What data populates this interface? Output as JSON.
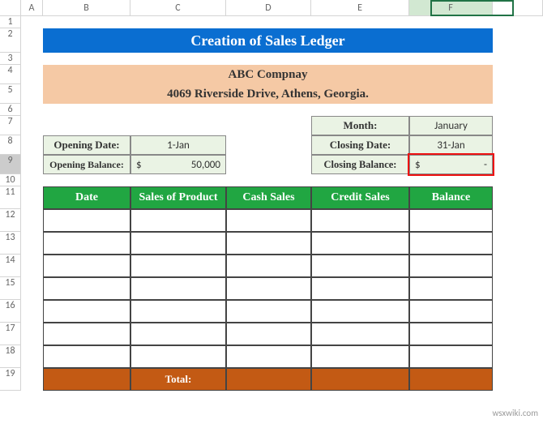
{
  "columns": [
    "A",
    "B",
    "C",
    "D",
    "E",
    "F"
  ],
  "rows": [
    "1",
    "2",
    "3",
    "4",
    "5",
    "6",
    "7",
    "8",
    "9",
    "10",
    "11",
    "12",
    "13",
    "14",
    "15",
    "16",
    "17",
    "18",
    "19"
  ],
  "title": "Creation of Sales Ledger",
  "company_name": "ABC Compnay",
  "company_addr": "4069 Riverside Drive, Athens, Georgia.",
  "open": {
    "date_label": "Opening Date:",
    "date_value": "1-Jan",
    "bal_label": "Opening Balance:",
    "bal_curr": "$",
    "bal_value": "50,000"
  },
  "close": {
    "month_label": "Month:",
    "month_value": "January",
    "date_label": "Closing Date:",
    "date_value": "31-Jan",
    "bal_label": "Closing Balance:",
    "bal_curr": "$",
    "bal_value": "-"
  },
  "table": {
    "headers": [
      "Date",
      "Sales of Product",
      "Cash Sales",
      "Credit Sales",
      "Balance"
    ],
    "total_label": "Total:"
  },
  "watermark": "wsxwiki.com"
}
